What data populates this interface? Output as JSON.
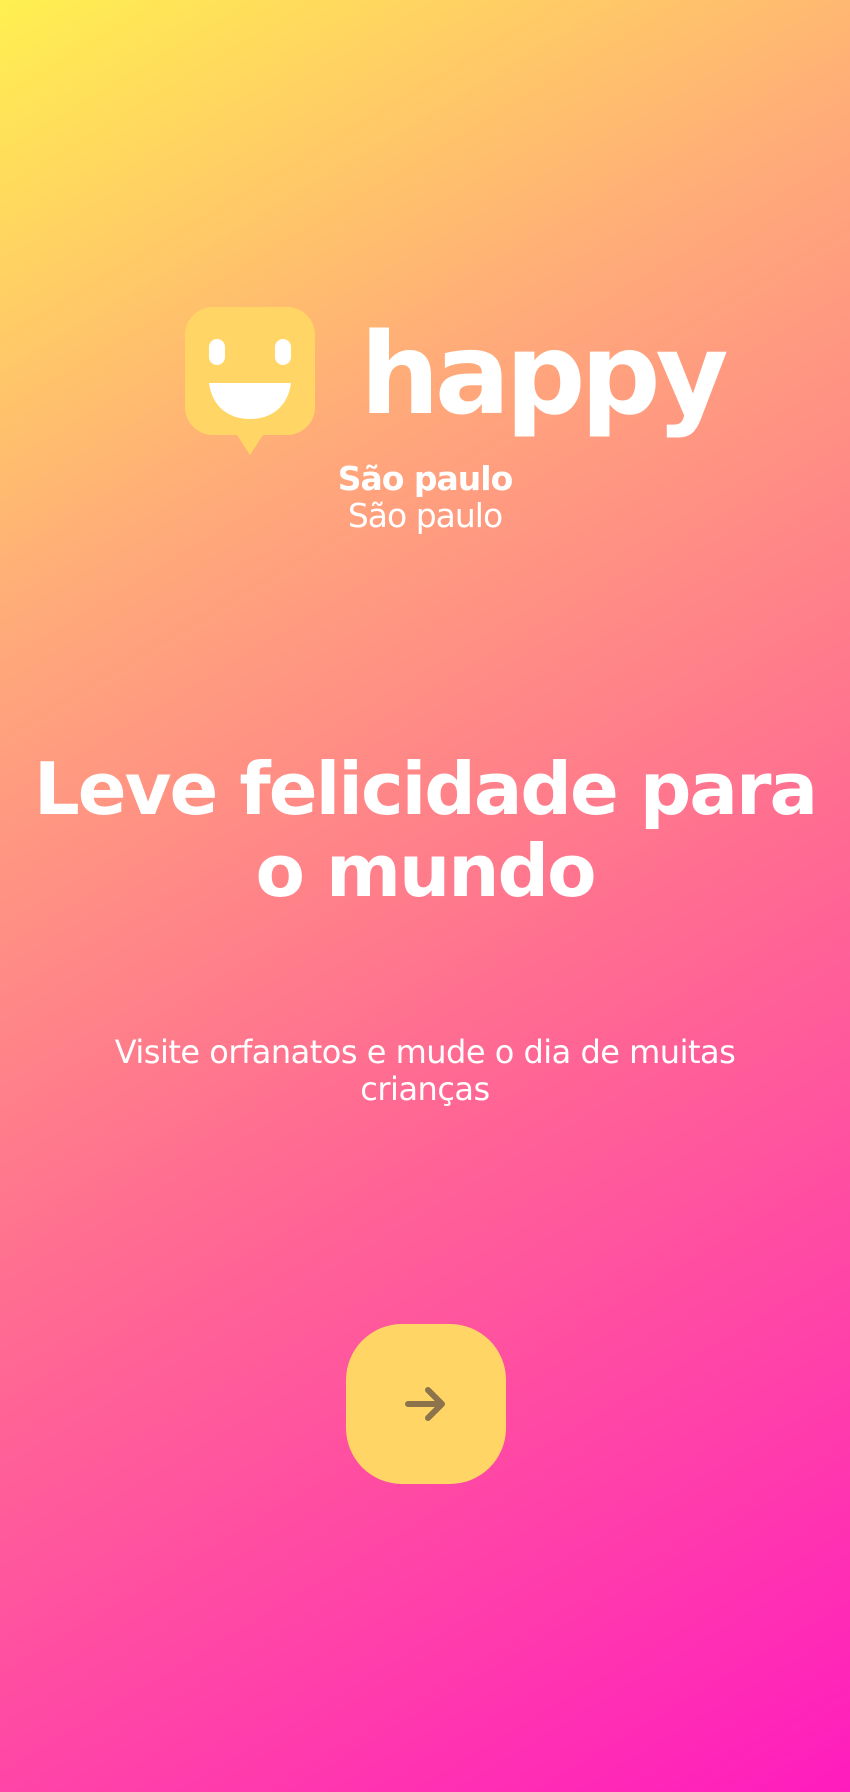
{
  "brand": {
    "name": "happy",
    "logo_icon": "smiley-chat-bubble-icon",
    "logo_color": "#ffd666"
  },
  "location": {
    "city": "São paulo",
    "state": "São paulo"
  },
  "hero": {
    "headline": "Leve felicidade para o mundo",
    "subtitle": "Visite orfanatos e mude o dia de muitas crianças"
  },
  "cta": {
    "icon": "arrow-right-icon",
    "background": "#ffd666",
    "icon_color": "#8d734b"
  },
  "theme": {
    "gradient_start": "#fff050",
    "gradient_end": "#ff1cbe",
    "text_color": "#ffffff"
  }
}
